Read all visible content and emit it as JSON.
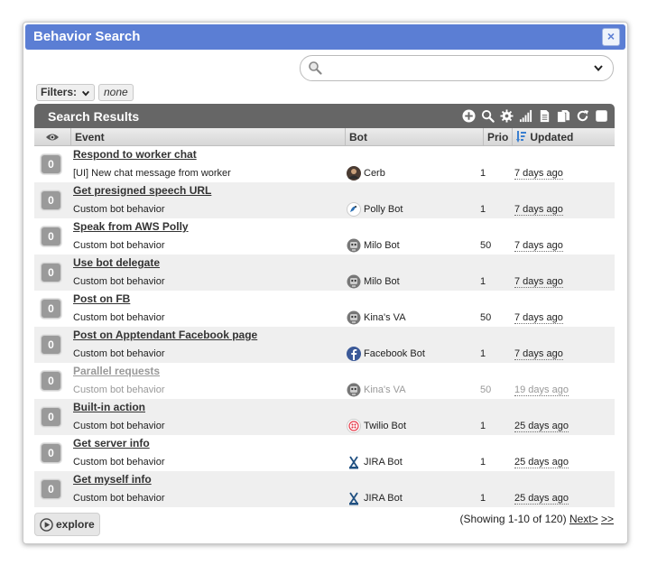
{
  "dialog": {
    "title": "Behavior Search",
    "close_label": "×"
  },
  "search": {
    "placeholder": "",
    "value": ""
  },
  "filters": {
    "label": "Filters:",
    "chip": "none"
  },
  "results": {
    "title": "Search Results",
    "tools": [
      "add-icon",
      "search-icon",
      "gear-icon",
      "chart-icon",
      "export-icon",
      "copy-icon",
      "refresh-icon",
      "select-all-checkbox"
    ]
  },
  "columns": {
    "watchers": "",
    "event": "Event",
    "bot": "Bot",
    "priority": "Prio",
    "updated": "Updated"
  },
  "rows": [
    {
      "watchers": "0",
      "name": "Respond to worker chat",
      "event": "[UI] New chat message from worker",
      "bot": "Cerb",
      "bot_icon": "cerb-avatar",
      "priority": "1",
      "updated": "7 days ago",
      "disabled": false
    },
    {
      "watchers": "0",
      "name": "Get presigned speech URL",
      "event": "Custom bot behavior",
      "bot": "Polly Bot",
      "bot_icon": "polly-avatar",
      "priority": "1",
      "updated": "7 days ago",
      "disabled": false
    },
    {
      "watchers": "0",
      "name": "Speak from AWS Polly",
      "event": "Custom bot behavior",
      "bot": "Milo Bot",
      "bot_icon": "robot-avatar",
      "priority": "50",
      "updated": "7 days ago",
      "disabled": false
    },
    {
      "watchers": "0",
      "name": "Use bot delegate",
      "event": "Custom bot behavior",
      "bot": "Milo Bot",
      "bot_icon": "robot-avatar",
      "priority": "1",
      "updated": "7 days ago",
      "disabled": false
    },
    {
      "watchers": "0",
      "name": "Post on FB",
      "event": "Custom bot behavior",
      "bot": "Kina's VA",
      "bot_icon": "robot-avatar",
      "priority": "50",
      "updated": "7 days ago",
      "disabled": false
    },
    {
      "watchers": "0",
      "name": "Post on Apptendant Facebook page",
      "event": "Custom bot behavior",
      "bot": "Facebook Bot",
      "bot_icon": "facebook-avatar",
      "priority": "1",
      "updated": "7 days ago",
      "disabled": false
    },
    {
      "watchers": "0",
      "name": "Parallel requests",
      "event": "Custom bot behavior",
      "bot": "Kina's VA",
      "bot_icon": "robot-avatar",
      "priority": "50",
      "updated": "19 days ago",
      "disabled": true
    },
    {
      "watchers": "0",
      "name": "Built-in action",
      "event": "Custom bot behavior",
      "bot": "Twilio Bot",
      "bot_icon": "twilio-avatar",
      "priority": "1",
      "updated": "25 days ago",
      "disabled": false
    },
    {
      "watchers": "0",
      "name": "Get server info",
      "event": "Custom bot behavior",
      "bot": "JIRA Bot",
      "bot_icon": "jira-avatar",
      "priority": "1",
      "updated": "25 days ago",
      "disabled": false
    },
    {
      "watchers": "0",
      "name": "Get myself info",
      "event": "Custom bot behavior",
      "bot": "JIRA Bot",
      "bot_icon": "jira-avatar",
      "priority": "1",
      "updated": "25 days ago",
      "disabled": false
    }
  ],
  "footer": {
    "explore_label": "explore",
    "showing": "(Showing 1-10 of 120)",
    "next_label": "Next>",
    "last_label": ">>"
  }
}
